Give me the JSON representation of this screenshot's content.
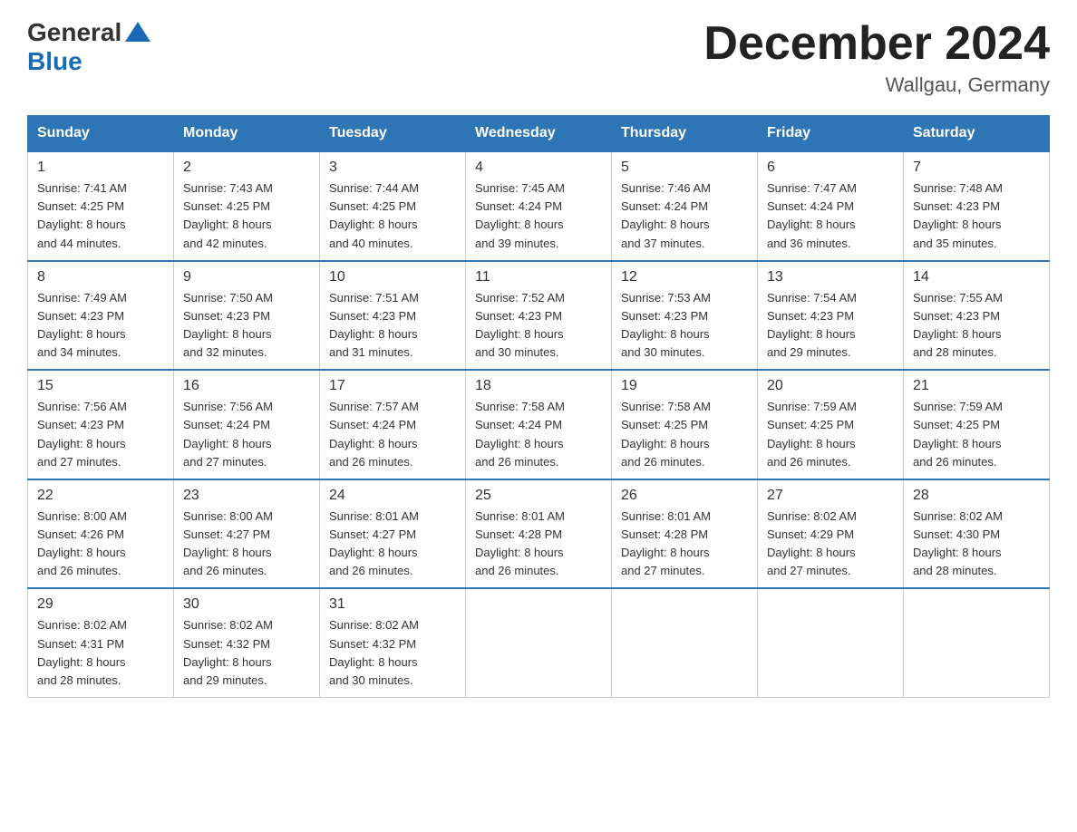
{
  "logo": {
    "general": "General",
    "blue": "Blue"
  },
  "title": "December 2024",
  "location": "Wallgau, Germany",
  "headers": [
    "Sunday",
    "Monday",
    "Tuesday",
    "Wednesday",
    "Thursday",
    "Friday",
    "Saturday"
  ],
  "weeks": [
    [
      {
        "day": "1",
        "info": "Sunrise: 7:41 AM\nSunset: 4:25 PM\nDaylight: 8 hours\nand 44 minutes."
      },
      {
        "day": "2",
        "info": "Sunrise: 7:43 AM\nSunset: 4:25 PM\nDaylight: 8 hours\nand 42 minutes."
      },
      {
        "day": "3",
        "info": "Sunrise: 7:44 AM\nSunset: 4:25 PM\nDaylight: 8 hours\nand 40 minutes."
      },
      {
        "day": "4",
        "info": "Sunrise: 7:45 AM\nSunset: 4:24 PM\nDaylight: 8 hours\nand 39 minutes."
      },
      {
        "day": "5",
        "info": "Sunrise: 7:46 AM\nSunset: 4:24 PM\nDaylight: 8 hours\nand 37 minutes."
      },
      {
        "day": "6",
        "info": "Sunrise: 7:47 AM\nSunset: 4:24 PM\nDaylight: 8 hours\nand 36 minutes."
      },
      {
        "day": "7",
        "info": "Sunrise: 7:48 AM\nSunset: 4:23 PM\nDaylight: 8 hours\nand 35 minutes."
      }
    ],
    [
      {
        "day": "8",
        "info": "Sunrise: 7:49 AM\nSunset: 4:23 PM\nDaylight: 8 hours\nand 34 minutes."
      },
      {
        "day": "9",
        "info": "Sunrise: 7:50 AM\nSunset: 4:23 PM\nDaylight: 8 hours\nand 32 minutes."
      },
      {
        "day": "10",
        "info": "Sunrise: 7:51 AM\nSunset: 4:23 PM\nDaylight: 8 hours\nand 31 minutes."
      },
      {
        "day": "11",
        "info": "Sunrise: 7:52 AM\nSunset: 4:23 PM\nDaylight: 8 hours\nand 30 minutes."
      },
      {
        "day": "12",
        "info": "Sunrise: 7:53 AM\nSunset: 4:23 PM\nDaylight: 8 hours\nand 30 minutes."
      },
      {
        "day": "13",
        "info": "Sunrise: 7:54 AM\nSunset: 4:23 PM\nDaylight: 8 hours\nand 29 minutes."
      },
      {
        "day": "14",
        "info": "Sunrise: 7:55 AM\nSunset: 4:23 PM\nDaylight: 8 hours\nand 28 minutes."
      }
    ],
    [
      {
        "day": "15",
        "info": "Sunrise: 7:56 AM\nSunset: 4:23 PM\nDaylight: 8 hours\nand 27 minutes."
      },
      {
        "day": "16",
        "info": "Sunrise: 7:56 AM\nSunset: 4:24 PM\nDaylight: 8 hours\nand 27 minutes."
      },
      {
        "day": "17",
        "info": "Sunrise: 7:57 AM\nSunset: 4:24 PM\nDaylight: 8 hours\nand 26 minutes."
      },
      {
        "day": "18",
        "info": "Sunrise: 7:58 AM\nSunset: 4:24 PM\nDaylight: 8 hours\nand 26 minutes."
      },
      {
        "day": "19",
        "info": "Sunrise: 7:58 AM\nSunset: 4:25 PM\nDaylight: 8 hours\nand 26 minutes."
      },
      {
        "day": "20",
        "info": "Sunrise: 7:59 AM\nSunset: 4:25 PM\nDaylight: 8 hours\nand 26 minutes."
      },
      {
        "day": "21",
        "info": "Sunrise: 7:59 AM\nSunset: 4:25 PM\nDaylight: 8 hours\nand 26 minutes."
      }
    ],
    [
      {
        "day": "22",
        "info": "Sunrise: 8:00 AM\nSunset: 4:26 PM\nDaylight: 8 hours\nand 26 minutes."
      },
      {
        "day": "23",
        "info": "Sunrise: 8:00 AM\nSunset: 4:27 PM\nDaylight: 8 hours\nand 26 minutes."
      },
      {
        "day": "24",
        "info": "Sunrise: 8:01 AM\nSunset: 4:27 PM\nDaylight: 8 hours\nand 26 minutes."
      },
      {
        "day": "25",
        "info": "Sunrise: 8:01 AM\nSunset: 4:28 PM\nDaylight: 8 hours\nand 26 minutes."
      },
      {
        "day": "26",
        "info": "Sunrise: 8:01 AM\nSunset: 4:28 PM\nDaylight: 8 hours\nand 27 minutes."
      },
      {
        "day": "27",
        "info": "Sunrise: 8:02 AM\nSunset: 4:29 PM\nDaylight: 8 hours\nand 27 minutes."
      },
      {
        "day": "28",
        "info": "Sunrise: 8:02 AM\nSunset: 4:30 PM\nDaylight: 8 hours\nand 28 minutes."
      }
    ],
    [
      {
        "day": "29",
        "info": "Sunrise: 8:02 AM\nSunset: 4:31 PM\nDaylight: 8 hours\nand 28 minutes."
      },
      {
        "day": "30",
        "info": "Sunrise: 8:02 AM\nSunset: 4:32 PM\nDaylight: 8 hours\nand 29 minutes."
      },
      {
        "day": "31",
        "info": "Sunrise: 8:02 AM\nSunset: 4:32 PM\nDaylight: 8 hours\nand 30 minutes."
      },
      {
        "day": "",
        "info": ""
      },
      {
        "day": "",
        "info": ""
      },
      {
        "day": "",
        "info": ""
      },
      {
        "day": "",
        "info": ""
      }
    ]
  ]
}
